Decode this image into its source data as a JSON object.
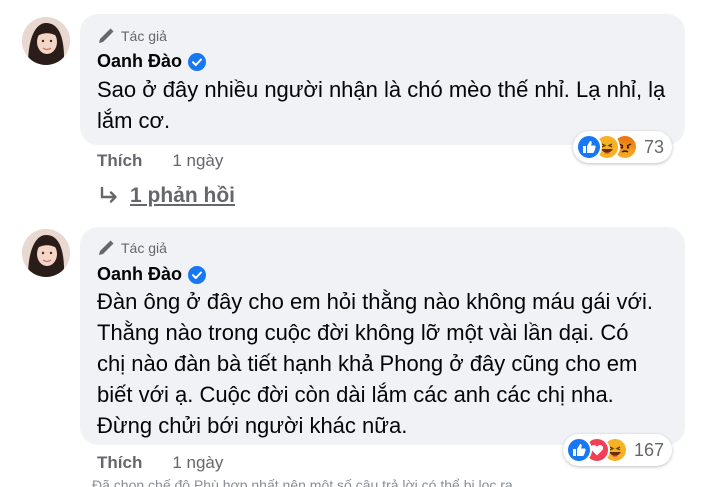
{
  "comments": [
    {
      "author_tag": "Tác giả",
      "author_name": "Oanh Đào",
      "text_lines": [
        "Sao ở đây nhiều người nhận là chó mèo thế nhỉ. Lạ nhỉ, lạ",
        "lắm cơ."
      ],
      "reaction_count": "73",
      "reactions": [
        "like-icon",
        "haha-icon",
        "angry-icon"
      ],
      "like_label": "Thích",
      "time": "1 ngày",
      "replies_label": "1 phản hồi"
    },
    {
      "author_tag": "Tác giả",
      "author_name": "Oanh Đào",
      "text_lines": [
        "Đàn ông ở đây cho em hỏi thằng nào không máu gái với.",
        "Thằng nào trong cuộc đời không lỡ một vài lần dại. Có",
        "chị nào đàn bà tiết hạnh khả Phong ở đây cũng cho em",
        "biết với ạ. Cuộc đời còn dài lắm các anh các chị nha.",
        "Đừng chửi bới người khác nữa."
      ],
      "reaction_count": "167",
      "reactions": [
        "like-icon",
        "love-icon",
        "haha-icon"
      ],
      "like_label": "Thích",
      "time": "1 ngày"
    }
  ],
  "footer_note": "Đã chọn chế độ Phù hợp nhất nên một số câu trả lời có thể bị lọc ra.",
  "colors": {
    "bubble": "#f0f2f5",
    "verified": "#1877f2",
    "secondary_text": "#65676b",
    "like_blue": "#1877f2",
    "love_red": "#f33e58",
    "haha_yellow": "#f7b125",
    "angry_orange": "#e9710f"
  }
}
